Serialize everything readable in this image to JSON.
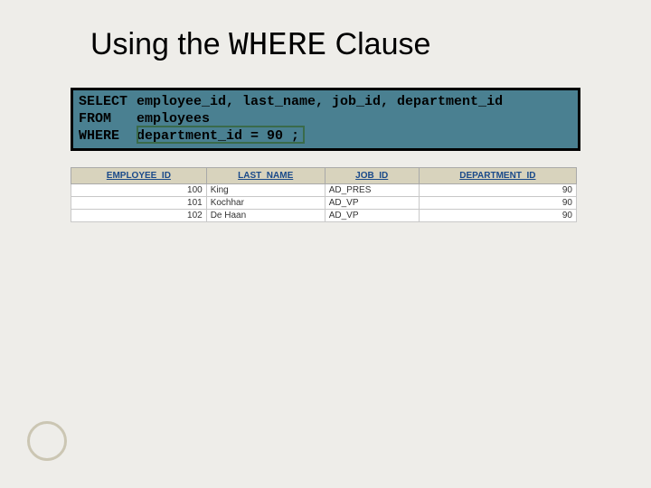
{
  "title": {
    "pre": "Using the ",
    "mono": "WHERE",
    "post": " Clause"
  },
  "code": {
    "line1_kw": "SELECT",
    "line1_rest": "employee_id, last_name, job_id, department_id",
    "line2_kw": "FROM",
    "line2_rest": "employees",
    "line3_kw": "WHERE",
    "line3_rest": "department_id = 90 ;"
  },
  "table": {
    "headers": [
      "EMPLOYEE_ID",
      "LAST_NAME",
      "JOB_ID",
      "DEPARTMENT_ID"
    ],
    "rows": [
      {
        "employee_id": "100",
        "last_name": "King",
        "job_id": "AD_PRES",
        "department_id": "90"
      },
      {
        "employee_id": "101",
        "last_name": "Kochhar",
        "job_id": "AD_VP",
        "department_id": "90"
      },
      {
        "employee_id": "102",
        "last_name": "De Haan",
        "job_id": "AD_VP",
        "department_id": "90"
      }
    ]
  }
}
